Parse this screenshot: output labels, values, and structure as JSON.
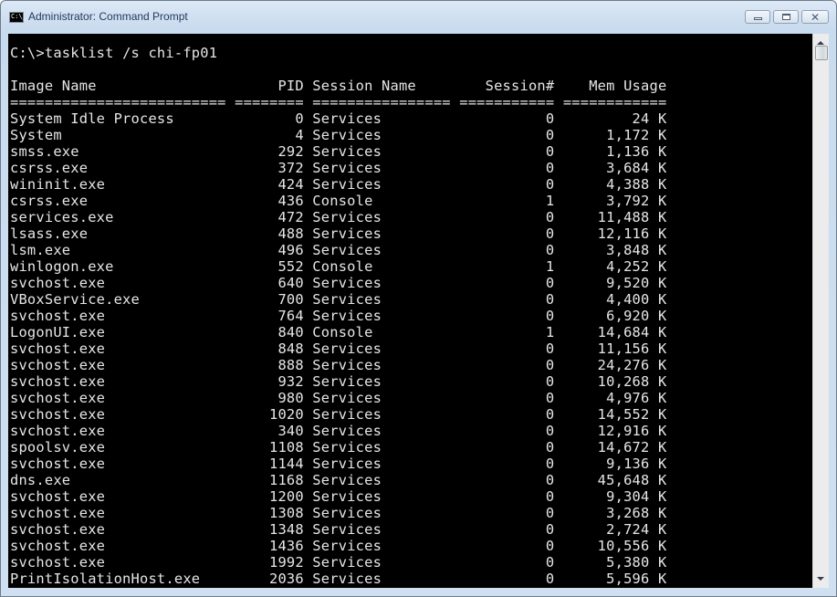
{
  "window": {
    "title": "Administrator: Command Prompt",
    "icon": "cmd-icon",
    "icon_text": "C:\\_",
    "buttons": {
      "minimize": "minimize-icon",
      "maximize": "maximize-icon",
      "close": "close-icon"
    }
  },
  "console": {
    "prompt": "C:\\>",
    "command": "tasklist /s chi-fp01",
    "headers": [
      "Image Name",
      "PID",
      "Session Name",
      "Session#",
      "Mem Usage"
    ],
    "separator_widths": [
      25,
      8,
      16,
      11,
      12
    ],
    "rows": [
      [
        "System Idle Process",
        "0",
        "Services",
        "0",
        "24 K"
      ],
      [
        "System",
        "4",
        "Services",
        "0",
        "1,172 K"
      ],
      [
        "smss.exe",
        "292",
        "Services",
        "0",
        "1,136 K"
      ],
      [
        "csrss.exe",
        "372",
        "Services",
        "0",
        "3,684 K"
      ],
      [
        "wininit.exe",
        "424",
        "Services",
        "0",
        "4,388 K"
      ],
      [
        "csrss.exe",
        "436",
        "Console",
        "1",
        "3,792 K"
      ],
      [
        "services.exe",
        "472",
        "Services",
        "0",
        "11,488 K"
      ],
      [
        "lsass.exe",
        "488",
        "Services",
        "0",
        "12,116 K"
      ],
      [
        "lsm.exe",
        "496",
        "Services",
        "0",
        "3,848 K"
      ],
      [
        "winlogon.exe",
        "552",
        "Console",
        "1",
        "4,252 K"
      ],
      [
        "svchost.exe",
        "640",
        "Services",
        "0",
        "9,520 K"
      ],
      [
        "VBoxService.exe",
        "700",
        "Services",
        "0",
        "4,400 K"
      ],
      [
        "svchost.exe",
        "764",
        "Services",
        "0",
        "6,920 K"
      ],
      [
        "LogonUI.exe",
        "840",
        "Console",
        "1",
        "14,684 K"
      ],
      [
        "svchost.exe",
        "848",
        "Services",
        "0",
        "11,156 K"
      ],
      [
        "svchost.exe",
        "888",
        "Services",
        "0",
        "24,276 K"
      ],
      [
        "svchost.exe",
        "932",
        "Services",
        "0",
        "10,268 K"
      ],
      [
        "svchost.exe",
        "980",
        "Services",
        "0",
        "4,976 K"
      ],
      [
        "svchost.exe",
        "1020",
        "Services",
        "0",
        "14,552 K"
      ],
      [
        "svchost.exe",
        "340",
        "Services",
        "0",
        "12,916 K"
      ],
      [
        "spoolsv.exe",
        "1108",
        "Services",
        "0",
        "14,672 K"
      ],
      [
        "svchost.exe",
        "1144",
        "Services",
        "0",
        "9,136 K"
      ],
      [
        "dns.exe",
        "1168",
        "Services",
        "0",
        "45,648 K"
      ],
      [
        "svchost.exe",
        "1200",
        "Services",
        "0",
        "9,304 K"
      ],
      [
        "svchost.exe",
        "1308",
        "Services",
        "0",
        "3,268 K"
      ],
      [
        "svchost.exe",
        "1348",
        "Services",
        "0",
        "2,724 K"
      ],
      [
        "svchost.exe",
        "1436",
        "Services",
        "0",
        "10,556 K"
      ],
      [
        "svchost.exe",
        "1992",
        "Services",
        "0",
        "5,380 K"
      ],
      [
        "PrintIsolationHost.exe",
        "2036",
        "Services",
        "0",
        "5,596 K"
      ]
    ]
  },
  "scrollbar": {
    "up": "scroll-up-arrow-icon",
    "down": "scroll-down-arrow-icon",
    "position": 0.0
  }
}
